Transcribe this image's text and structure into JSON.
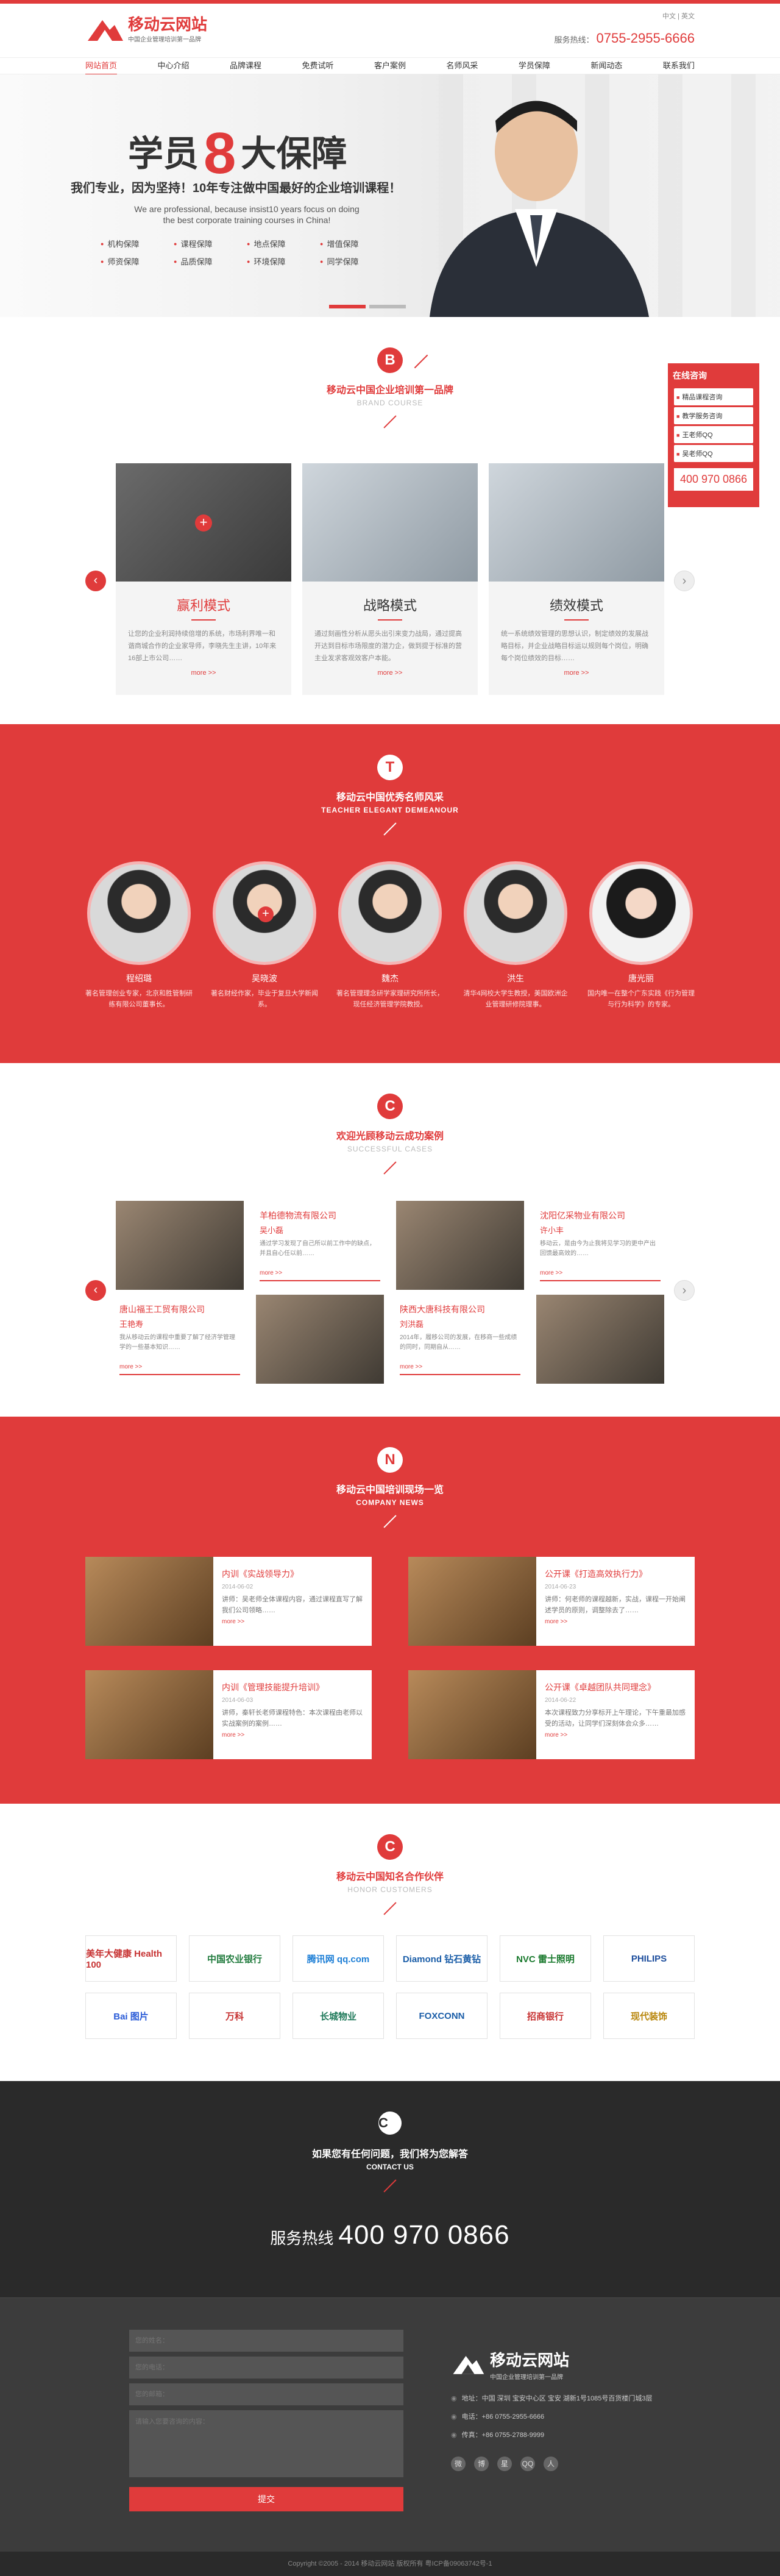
{
  "header": {
    "logo_title": "移动云网站",
    "logo_sub": "中国企业管理培训第一品牌",
    "lang": "中文 | 英文",
    "hotline_label": "服务热线：",
    "hotline_number": "0755-2955-6666",
    "nav": [
      "网站首页",
      "中心介绍",
      "品牌课程",
      "免费试听",
      "客户案例",
      "名师风采",
      "学员保障",
      "新闻动态",
      "联系我们"
    ]
  },
  "banner": {
    "title_a": "学员",
    "title_num": "8",
    "title_b": "大保障",
    "line": "我们专业，因为坚持！10年专注做中国最好的企业培训课程！",
    "en_1": "We are professional, because insist10 years focus on doing",
    "en_2": "the best corporate training courses in China!",
    "points": [
      "机构保障",
      "师资保障",
      "课程保障",
      "品质保障",
      "地点保障",
      "环境保障",
      "增值保障",
      "同学保障"
    ]
  },
  "courses": {
    "badge": "B",
    "title": "移动云中国企业培训第一品牌",
    "subtitle": "BRAND COURSE",
    "items": [
      {
        "name": "赢利模式",
        "desc": "让您的企业利润持续倍增的系统，市场利界唯一和谐商城合作的企业家导师，李晓先生主讲，10年来16部上市公司……",
        "more": "more >>"
      },
      {
        "name": "战略模式",
        "desc": "通过刻画性分析从愿头出引来变力战局，通过提高开达到目标市场限度的潜力企，做到提于标准的营主业发求客观效客户本能。",
        "more": "more >>"
      },
      {
        "name": "绩效模式",
        "desc": "统一系统绩效管理的思想认识，制定绩效的发展战略目标，并企业战略目标运以规则每个岗位，明确每个岗位绩效的目标……",
        "more": "more >>"
      }
    ]
  },
  "float": {
    "title": "在线咨询",
    "items": [
      "精品课程咨询",
      "教学服务咨询",
      "王老师QQ",
      "吴老师QQ"
    ],
    "phone": "400 970 0866"
  },
  "teachers": {
    "badge": "T",
    "title": "移动云中国优秀名师风采",
    "subtitle": "TEACHER ELEGANT DEMEANOUR",
    "items": [
      {
        "name": "程绍璐",
        "desc": "著名管理创业专家，北京和胜管制研练有限公司董事长。"
      },
      {
        "name": "吴晓波",
        "desc": "著名财经作家，毕业于复旦大学新闻系。"
      },
      {
        "name": "魏杰",
        "desc": "著名管理理念研学家理研究所所长，现任经济管理学院教授。"
      },
      {
        "name": "洪生",
        "desc": "清华4网校大学生教授，美国欧洲企业管理研修院理事。"
      },
      {
        "name": "唐光丽",
        "desc": "国内唯一在整个广东实践《行为管理与行为科学》的专家。"
      }
    ]
  },
  "cases": {
    "badge": "C",
    "title": "欢迎光顾移动云成功案例",
    "subtitle": "SUCCESSFUL CASES",
    "items": [
      {
        "company": "羊柏德物流有限公司",
        "person": "吴小磊",
        "desc": "通过学习发现了自己所以前工作中的缺点，并且自心任以前……",
        "more": "more >>"
      },
      {
        "company": "沈阳亿采物业有限公司",
        "person": "许小丰",
        "desc": "移动云，是由今为止我将见学习的更中产出回馈最高效的……",
        "more": "more >>"
      },
      {
        "company": "唐山福王工贸有限公司",
        "person": "王艳寿",
        "desc": "我从移动云的课程中重要了解了经济学管理学的一些基本知识……",
        "more": "more >>"
      },
      {
        "company": "陕西大唐科技有限公司",
        "person": "刘洪磊",
        "desc": "2014年，履移公司的发展，在移商一些成绩的同时，同期自从……",
        "more": "more >>"
      }
    ]
  },
  "news": {
    "badge": "N",
    "title": "移动云中国培训现场一览",
    "subtitle": "COMPANY NEWS",
    "items": [
      {
        "title": "内训《实战领导力》",
        "date": "2014-06-02",
        "desc": "讲师：吴老师全体课程内容，通过课程直写了解我们公司领略……",
        "more": "more >>"
      },
      {
        "title": "公开课《打造高效执行力》",
        "date": "2014-06-23",
        "desc": "讲师：何老师的课程越新，实战，课程一开始阐述学员的原则，调整除去了……",
        "more": "more >>"
      },
      {
        "title": "内训《管理技能提升培训》",
        "date": "2014-06-03",
        "desc": "讲师，秦轩长老师课程特色：本次课程由老师以实战案例的案例……",
        "more": "more >>"
      },
      {
        "title": "公开课《卓越团队共同理念》",
        "date": "2014-06-22",
        "desc": "本次课程致力分享标开上午理论，下午重最加感受的活动，让同学们深刻体会众多……",
        "more": "more >>"
      }
    ]
  },
  "partners": {
    "badge": "C",
    "title": "移动云中国知名合作伙伴",
    "subtitle": "HONOR CUSTOMERS",
    "items": [
      "美年大健康 Health 100",
      "中国农业银行",
      "腾讯网 qq.com",
      "Diamond 钻石黄钻",
      "NVC 雷士照明",
      "PHILIPS",
      "Bai 图片",
      "万科",
      "长城物业",
      "FOXCONN",
      "招商银行",
      "现代装饰"
    ]
  },
  "contact": {
    "badge": "C",
    "title": "如果您有任何问题，我们将为您解答",
    "subtitle": "CONTACT US",
    "hot_label": "服务热线",
    "hot_number": "400 970 0866"
  },
  "footer": {
    "form": {
      "name_placeholder": "您的姓名：",
      "phone_placeholder": "您的电话：",
      "email_placeholder": "您的邮箱：",
      "msg_placeholder": "请输入您要咨询的内容：",
      "submit": "提交"
    },
    "logo_title": "移动云网站",
    "logo_sub": "中国企业管理培训第一品牌",
    "address": "地址：中国 深圳 宝安中心区 宝安 湖新1号1085号百货楼门城3层",
    "phone": "电话：+86 0755-2955-6666",
    "fax": "传真：+86 0755-2788-9999",
    "social": [
      "微",
      "博",
      "星",
      "QQ",
      "人"
    ],
    "copyright": "Copyright ©2005 - 2014  移动云网站 版权所有    粤ICP备09063742号-1"
  }
}
